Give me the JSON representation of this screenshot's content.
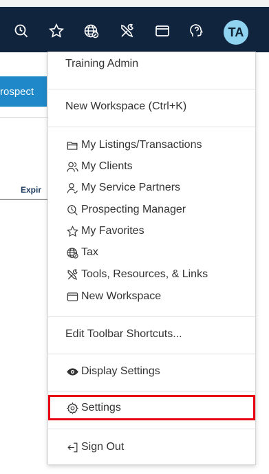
{
  "toolbar": {
    "icons": [
      "clock-search-icon",
      "star-icon",
      "globe-tax-icon",
      "tools-icon",
      "window-icon",
      "help-head-icon"
    ],
    "avatar_initials": "TA"
  },
  "background": {
    "prospect_button": "rospect",
    "column_header": "Expir"
  },
  "menu": {
    "user_name": "Training Admin",
    "new_workspace_shortcut": "New Workspace (Ctrl+K)",
    "items": [
      {
        "label": "My Listings/Transactions",
        "icon": "folder-icon"
      },
      {
        "label": "My Clients",
        "icon": "users-icon"
      },
      {
        "label": "My Service Partners",
        "icon": "user-partner-icon"
      },
      {
        "label": "Prospecting Manager",
        "icon": "clock-search-icon"
      },
      {
        "label": "My Favorites",
        "icon": "star-icon"
      },
      {
        "label": "Tax",
        "icon": "globe-tax-icon"
      },
      {
        "label": "Tools, Resources, & Links",
        "icon": "tools-icon"
      },
      {
        "label": "New Workspace",
        "icon": "window-icon"
      }
    ],
    "edit_toolbar": "Edit Toolbar Shortcuts...",
    "display_settings": "Display Settings",
    "settings": "Settings",
    "sign_out": "Sign Out"
  },
  "colors": {
    "toolbar_bg": "#10243e",
    "avatar_bg": "#8fd3f0",
    "prospect_bg": "#1f88c9",
    "highlight": "#e60012"
  }
}
